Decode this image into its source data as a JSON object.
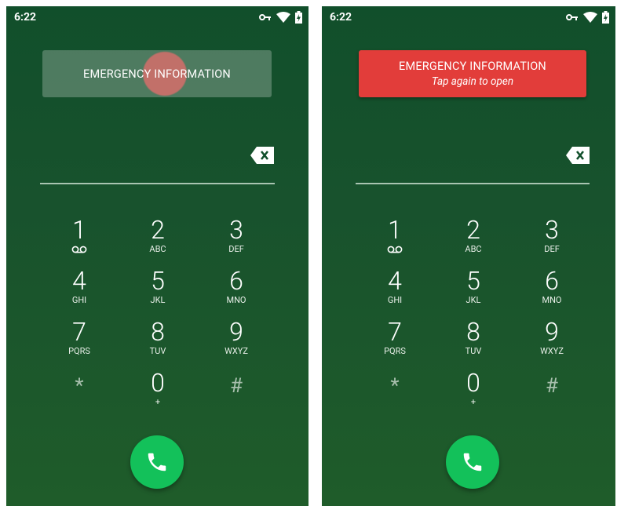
{
  "colors": {
    "background": "#1a5230",
    "emergency_active": "#e23d3a",
    "call_green": "#13c15a",
    "accent_text": "#ffffff"
  },
  "left": {
    "status": {
      "time": "6:22",
      "icons": [
        "vpn-key-icon",
        "wifi-icon",
        "battery-icon"
      ]
    },
    "emergency": {
      "title": "EMERGENCY INFORMATION"
    },
    "keys": [
      {
        "digit": "1",
        "letters": "",
        "sub_icon": "voicemail-icon"
      },
      {
        "digit": "2",
        "letters": "ABC"
      },
      {
        "digit": "3",
        "letters": "DEF"
      },
      {
        "digit": "4",
        "letters": "GHI"
      },
      {
        "digit": "5",
        "letters": "JKL"
      },
      {
        "digit": "6",
        "letters": "MNO"
      },
      {
        "digit": "7",
        "letters": "PQRS"
      },
      {
        "digit": "8",
        "letters": "TUV"
      },
      {
        "digit": "9",
        "letters": "WXYZ"
      },
      {
        "digit": "*",
        "letters": ""
      },
      {
        "digit": "0",
        "letters": "+"
      },
      {
        "digit": "#",
        "letters": ""
      }
    ]
  },
  "right": {
    "status": {
      "time": "6:22",
      "icons": [
        "vpn-key-icon",
        "wifi-icon",
        "battery-icon"
      ]
    },
    "emergency": {
      "title": "EMERGENCY INFORMATION",
      "subtitle": "Tap again to open"
    },
    "keys": [
      {
        "digit": "1",
        "letters": "",
        "sub_icon": "voicemail-icon"
      },
      {
        "digit": "2",
        "letters": "ABC"
      },
      {
        "digit": "3",
        "letters": "DEF"
      },
      {
        "digit": "4",
        "letters": "GHI"
      },
      {
        "digit": "5",
        "letters": "JKL"
      },
      {
        "digit": "6",
        "letters": "MNO"
      },
      {
        "digit": "7",
        "letters": "PQRS"
      },
      {
        "digit": "8",
        "letters": "TUV"
      },
      {
        "digit": "9",
        "letters": "WXYZ"
      },
      {
        "digit": "*",
        "letters": ""
      },
      {
        "digit": "0",
        "letters": "+"
      },
      {
        "digit": "#",
        "letters": ""
      }
    ]
  }
}
